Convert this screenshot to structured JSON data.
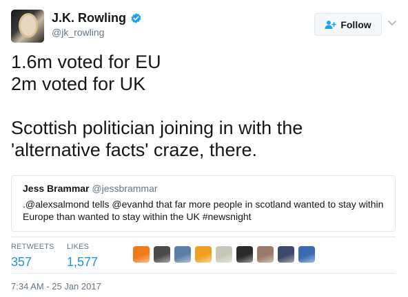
{
  "author": {
    "name": "J.K. Rowling",
    "handle": "@jk_rowling",
    "avatar_icon": "profile-photo-icon",
    "verified_icon": "verified-badge-icon"
  },
  "follow_button": {
    "label": "Follow",
    "icon": "follow-person-icon"
  },
  "caret_icon": "chevron-down-icon",
  "tweet": {
    "lines": [
      "1.6m voted for EU",
      "2m voted for UK",
      "",
      "Scottish politician joining in with the",
      "'alternative facts' craze, there."
    ]
  },
  "quoted_tweet": {
    "name": "Jess Brammar",
    "handle": "@jessbrammar",
    "text_line1": ".@alexsalmond tells @evanhd that far more people in scotland wanted to stay within",
    "text_line2": "Europe than wanted to stay within the UK #newsnight"
  },
  "stats": {
    "retweets_label": "RETWEETS",
    "retweets_value": "357",
    "likes_label": "LIKES",
    "likes_value": "1,577"
  },
  "likers": [
    {
      "icon": "liker-avatar-icon",
      "color": "#f07a1a"
    },
    {
      "icon": "liker-avatar-icon",
      "color": "#4a4a4a"
    },
    {
      "icon": "liker-avatar-icon",
      "color": "#5a7ea8"
    },
    {
      "icon": "liker-avatar-icon",
      "color": "#f0a020"
    },
    {
      "icon": "liker-avatar-icon",
      "color": "#c8c8b8"
    },
    {
      "icon": "liker-avatar-icon",
      "color": "#2a2a2a"
    },
    {
      "icon": "liker-avatar-icon",
      "color": "#9a7a6a"
    },
    {
      "icon": "liker-avatar-icon",
      "color": "#3a4a6a"
    },
    {
      "icon": "liker-avatar-icon",
      "color": "#3a6ab0"
    }
  ],
  "timestamp": "7:34 AM - 25 Jan 2017",
  "colors": {
    "link_blue": "#1b95e0",
    "verified_blue": "#1da1f2",
    "secondary_text": "#657786",
    "border": "#e1e8ed"
  }
}
